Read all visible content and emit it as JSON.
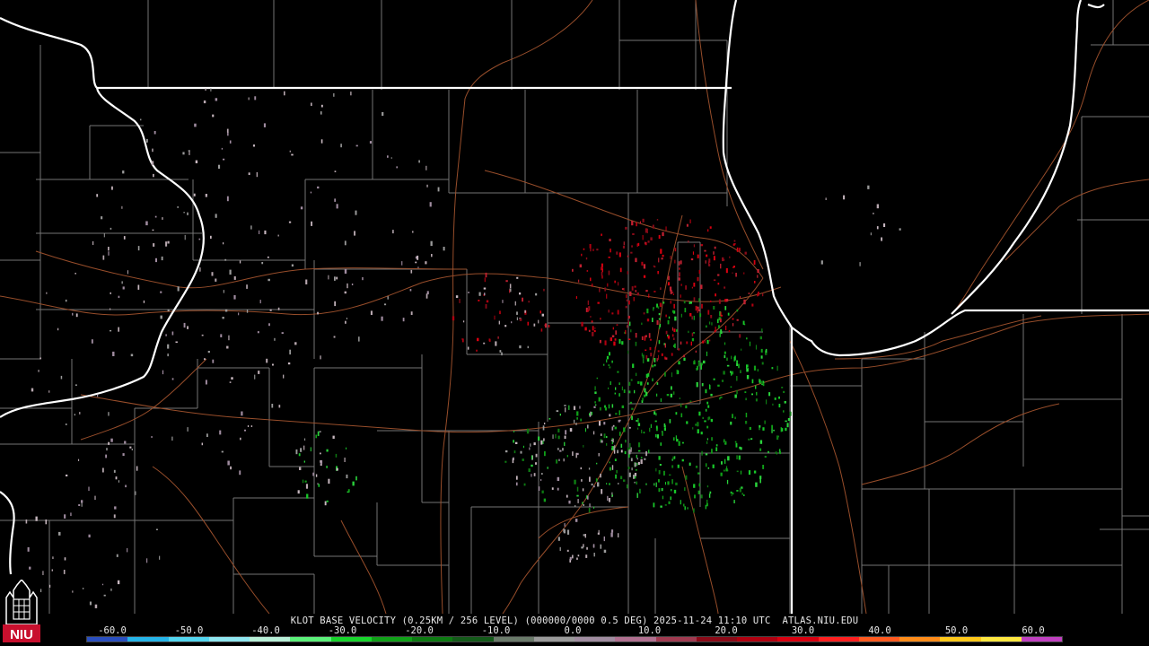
{
  "product_line": "KLOT BASE VELOCITY (0.25KM / 256 LEVEL) (000000/0000 0.5 DEG) 2025-11-24 11:10 UTC  ATLAS.NIU.EDU",
  "logo": {
    "icon": "niu-logo-icon",
    "text": "NIU",
    "color": "#c8102e"
  },
  "colorbar": {
    "ticks": [
      "-60.0",
      "-50.0",
      "-40.0",
      "-30.0",
      "-20.0",
      "-10.0",
      "0.0",
      "10.0",
      "20.0",
      "30.0",
      "40.0",
      "50.0",
      "60.0"
    ],
    "colors": [
      "#2a4fbf",
      "#25b4e8",
      "#54d6f0",
      "#8fe6f0",
      "#b8f0d8",
      "#5cf07a",
      "#18d42c",
      "#10a018",
      "#0d7a12",
      "#145a1a",
      "#6a7a6a",
      "#9a9a9a",
      "#a08ca0",
      "#b07090",
      "#a03a50",
      "#8a0a18",
      "#b00010",
      "#d80010",
      "#ff2020",
      "#ff5a20",
      "#ff8c1a",
      "#ffc81a",
      "#ffe840",
      "#c040c0"
    ]
  }
}
